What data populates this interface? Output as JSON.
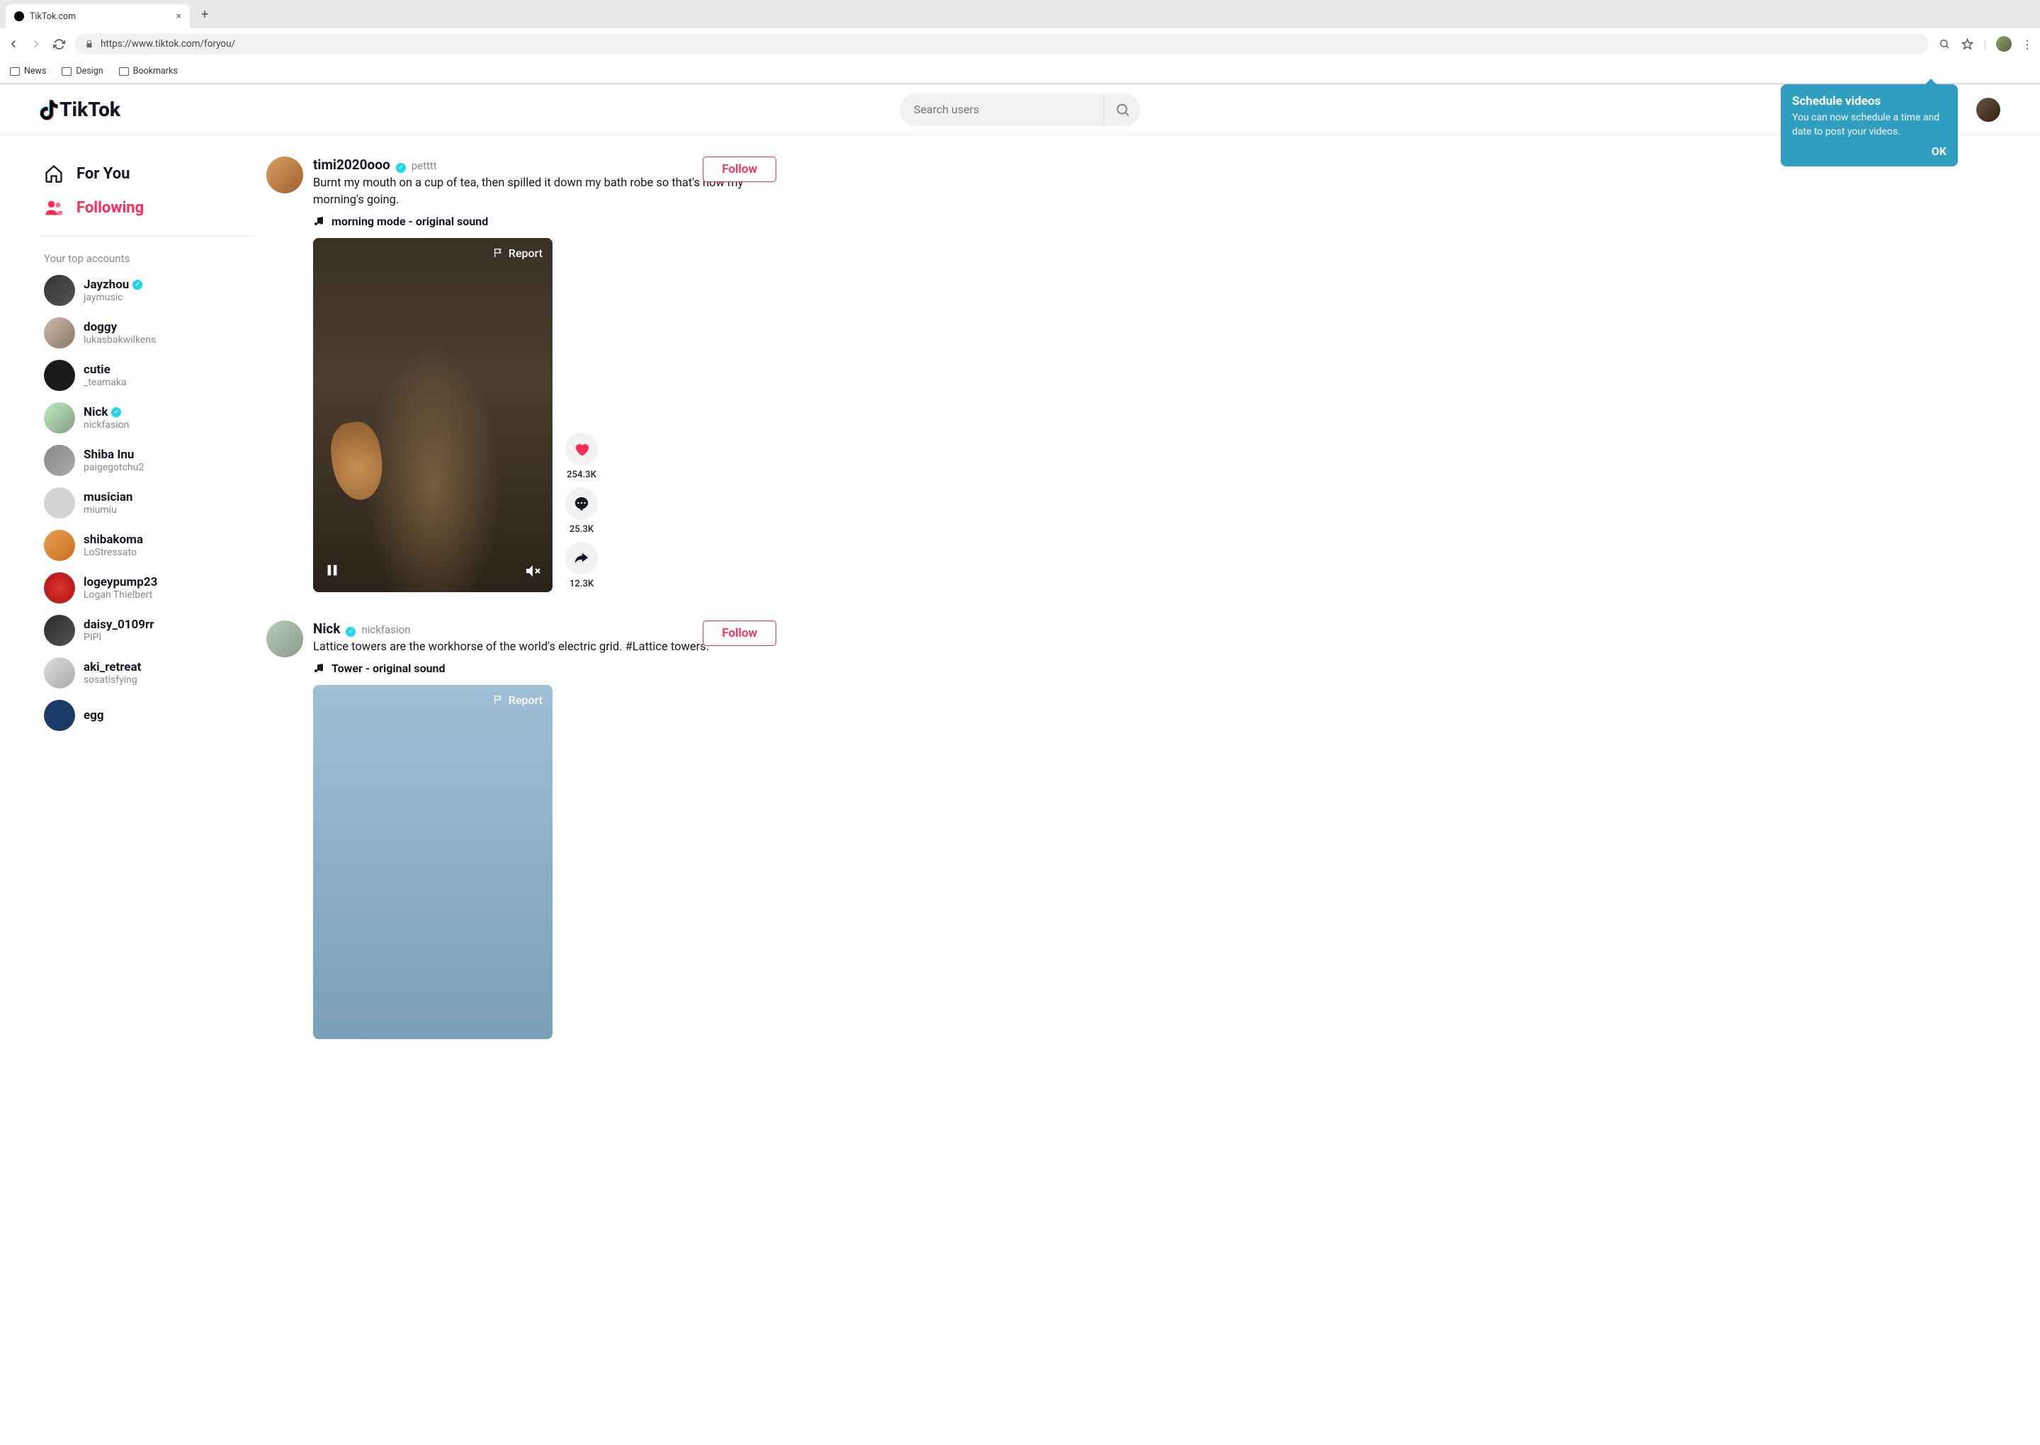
{
  "browser": {
    "tab_title": "TikTok.com",
    "url": "https://www.tiktok.com/foryou/",
    "bookmarks": [
      "News",
      "Design",
      "Bookmarks"
    ]
  },
  "header": {
    "logo_text": "TikTok",
    "search_placeholder": "Search users"
  },
  "tooltip": {
    "title": "Schedule videos",
    "body": "You can now schedule a time and date to post your videos.",
    "ok": "OK"
  },
  "sidebar": {
    "nav": [
      {
        "label": "For You",
        "icon": "home"
      },
      {
        "label": "Following",
        "icon": "people"
      }
    ],
    "top_label": "Your top accounts",
    "accounts": [
      {
        "name": "Jayzhou",
        "handle": "jaymusic",
        "verified": true,
        "av": "av1"
      },
      {
        "name": "doggy",
        "handle": "lukasbakwilkens",
        "verified": false,
        "av": "av2"
      },
      {
        "name": "cutie",
        "handle": "_teamaka",
        "verified": false,
        "av": "av3"
      },
      {
        "name": "Nick",
        "handle": "nickfasion",
        "verified": true,
        "av": "av4"
      },
      {
        "name": "Shiba Inu",
        "handle": "paigegotchu2",
        "verified": false,
        "av": "av5"
      },
      {
        "name": "musician",
        "handle": "miumiu",
        "verified": false,
        "av": "av6"
      },
      {
        "name": "shibakoma",
        "handle": "LoStressato",
        "verified": false,
        "av": "av7"
      },
      {
        "name": "logeypump23",
        "handle": "Logan Thielbert",
        "verified": false,
        "av": "av8"
      },
      {
        "name": "daisy_0109rr",
        "handle": "PIPI",
        "verified": false,
        "av": "av9"
      },
      {
        "name": "aki_retreat",
        "handle": "sosatisfying",
        "verified": false,
        "av": "av10"
      },
      {
        "name": "egg",
        "handle": "",
        "verified": false,
        "av": "av11"
      }
    ]
  },
  "feed": [
    {
      "username": "timi2020ooo",
      "verified": true,
      "handle": "petttt",
      "caption": "Burnt my mouth on a cup of tea, then spilled it down my bath robe so that's how my morning's going.",
      "music": "morning mode - original sound",
      "follow": "Follow",
      "report": "Report",
      "likes": "254.3K",
      "comments": "25.3K",
      "shares": "12.3K"
    },
    {
      "username": "Nick",
      "verified": true,
      "handle": "nickfasion",
      "caption": "Lattice towers are the workhorse of the world's electric grid. #Lattice towers.",
      "music": "Tower - original sound",
      "follow": "Follow",
      "report": "Report"
    }
  ]
}
